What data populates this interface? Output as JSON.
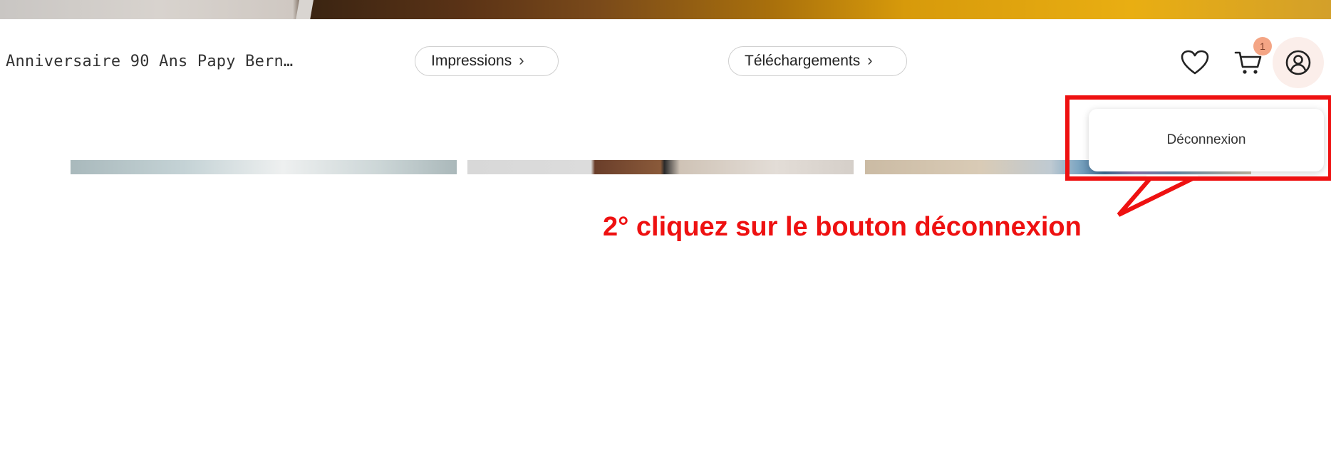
{
  "header": {
    "album_title": "Anniversaire 90 Ans Papy Bern…",
    "impressions_label": "Impressions",
    "telechargements_label": "Téléchargements",
    "favorites_icon": "heart-icon",
    "cart_icon": "cart-icon",
    "cart_count": "1",
    "account_icon": "user-icon"
  },
  "account_menu": {
    "logout_label": "Déconnexion"
  },
  "annotation": {
    "text": "2° cliquez sur le bouton déconnexion",
    "color": "#ee1111"
  },
  "colors": {
    "badge": "#f4a585",
    "account_button_bg": "#fbeeea"
  }
}
